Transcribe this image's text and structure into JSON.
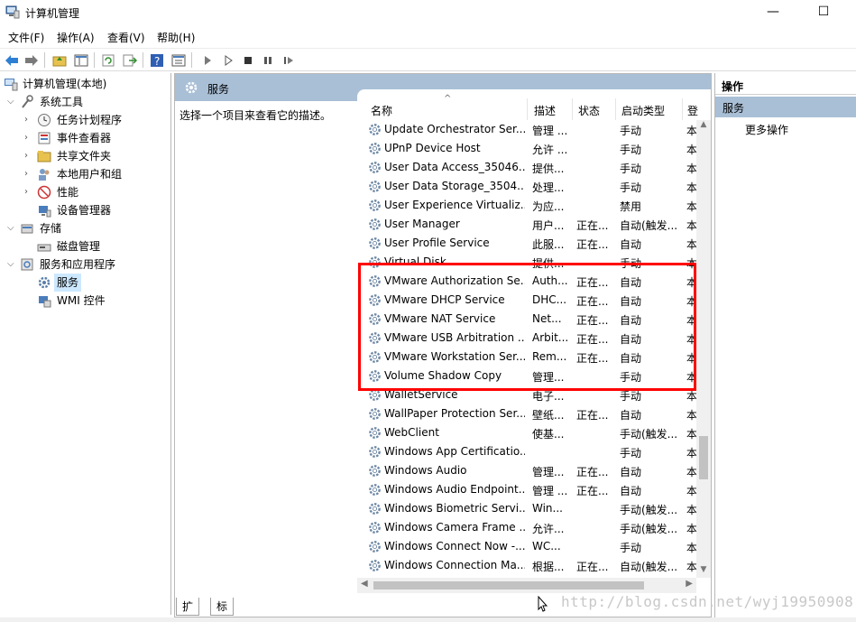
{
  "window": {
    "title": "计算机管理",
    "minimize_icon": "minimize-icon",
    "maximize_icon": "maximize-icon"
  },
  "menu": [
    "文件(F)",
    "操作(A)",
    "查看(V)",
    "帮助(H)"
  ],
  "toolbar": [
    "back-icon",
    "forward-icon",
    "up-folder-icon",
    "show-hide-tree-icon",
    "refresh-icon",
    "export-icon",
    "help-icon",
    "properties-icon",
    "start-icon",
    "start-alt-icon",
    "stop-icon",
    "pause-icon",
    "restart-icon"
  ],
  "tree": {
    "root": "计算机管理(本地)",
    "items": [
      {
        "label": "系统工具",
        "icon": "tools-icon",
        "expanded": true
      },
      {
        "label": "任务计划程序",
        "icon": "clock-icon"
      },
      {
        "label": "事件查看器",
        "icon": "event-viewer-icon"
      },
      {
        "label": "共享文件夹",
        "icon": "shared-folder-icon"
      },
      {
        "label": "本地用户和组",
        "icon": "users-icon"
      },
      {
        "label": "性能",
        "icon": "performance-icon"
      },
      {
        "label": "设备管理器",
        "icon": "device-manager-icon"
      },
      {
        "label": "存储",
        "icon": "storage-icon",
        "expanded": true
      },
      {
        "label": "磁盘管理",
        "icon": "disk-icon"
      },
      {
        "label": "服务和应用程序",
        "icon": "services-apps-icon",
        "expanded": true
      },
      {
        "label": "服务",
        "icon": "services-icon",
        "selected": true
      },
      {
        "label": "WMI 控件",
        "icon": "wmi-icon"
      }
    ]
  },
  "middle": {
    "header": "服务",
    "description": "选择一个项目来查看它的描述。",
    "columns": [
      "名称",
      "描述",
      "状态",
      "启动类型",
      "登"
    ],
    "rows": [
      [
        "Update Orchestrator Ser...",
        "管理 ...",
        "",
        "手动",
        "本"
      ],
      [
        "UPnP Device Host",
        "允许 ...",
        "",
        "手动",
        "本"
      ],
      [
        "User Data Access_35046...",
        "提供...",
        "",
        "手动",
        "本"
      ],
      [
        "User Data Storage_3504...",
        "处理...",
        "",
        "手动",
        "本"
      ],
      [
        "User Experience Virtualiz...",
        "为应...",
        "",
        "禁用",
        "本"
      ],
      [
        "User Manager",
        "用户...",
        "正在...",
        "自动(触发...",
        "本"
      ],
      [
        "User Profile Service",
        "此服...",
        "正在...",
        "自动",
        "本"
      ],
      [
        "Virtual Disk",
        "提供...",
        "",
        "手动",
        "本"
      ],
      [
        "VMware Authorization Se...",
        "Auth...",
        "正在...",
        "自动",
        "本"
      ],
      [
        "VMware DHCP Service",
        "DHC...",
        "正在...",
        "自动",
        "本"
      ],
      [
        "VMware NAT Service",
        "Net...",
        "正在...",
        "自动",
        "本"
      ],
      [
        "VMware USB Arbitration ...",
        "Arbit...",
        "正在...",
        "自动",
        "本"
      ],
      [
        "VMware Workstation Ser...",
        "Rem...",
        "正在...",
        "自动",
        "本"
      ],
      [
        "Volume Shadow Copy",
        "管理...",
        "",
        "手动",
        "本"
      ],
      [
        "WalletService",
        "电子...",
        "",
        "手动",
        "本"
      ],
      [
        "WallPaper Protection Ser...",
        "壁纸...",
        "正在...",
        "自动",
        "本"
      ],
      [
        "WebClient",
        "使基...",
        "",
        "手动(触发...",
        "本"
      ],
      [
        "Windows App Certificatio...",
        "",
        "",
        "手动",
        "本"
      ],
      [
        "Windows Audio",
        "管理...",
        "正在...",
        "自动",
        "本"
      ],
      [
        "Windows Audio Endpoint...",
        "管理 ...",
        "正在...",
        "自动",
        "本"
      ],
      [
        "Windows Biometric Servi...",
        "Win...",
        "",
        "手动(触发...",
        "本"
      ],
      [
        "Windows Camera Frame ...",
        "允许...",
        "",
        "手动(触发...",
        "本"
      ],
      [
        "Windows Connect Now -...",
        "WC...",
        "",
        "手动",
        "本"
      ],
      [
        "Windows Connection Ma...",
        "根据...",
        "正在...",
        "自动(触发...",
        "本"
      ]
    ],
    "tabs": [
      "扩展",
      "标准"
    ]
  },
  "actions": {
    "header": "操作",
    "section": "服务",
    "more": "更多操作"
  },
  "watermark": "http://blog.csdn.net/wyj19950908",
  "colors": {
    "highlight_box": "#ff0000",
    "pane_header": "#a9bfd6",
    "selected_tree_item": "#cce8ff"
  }
}
